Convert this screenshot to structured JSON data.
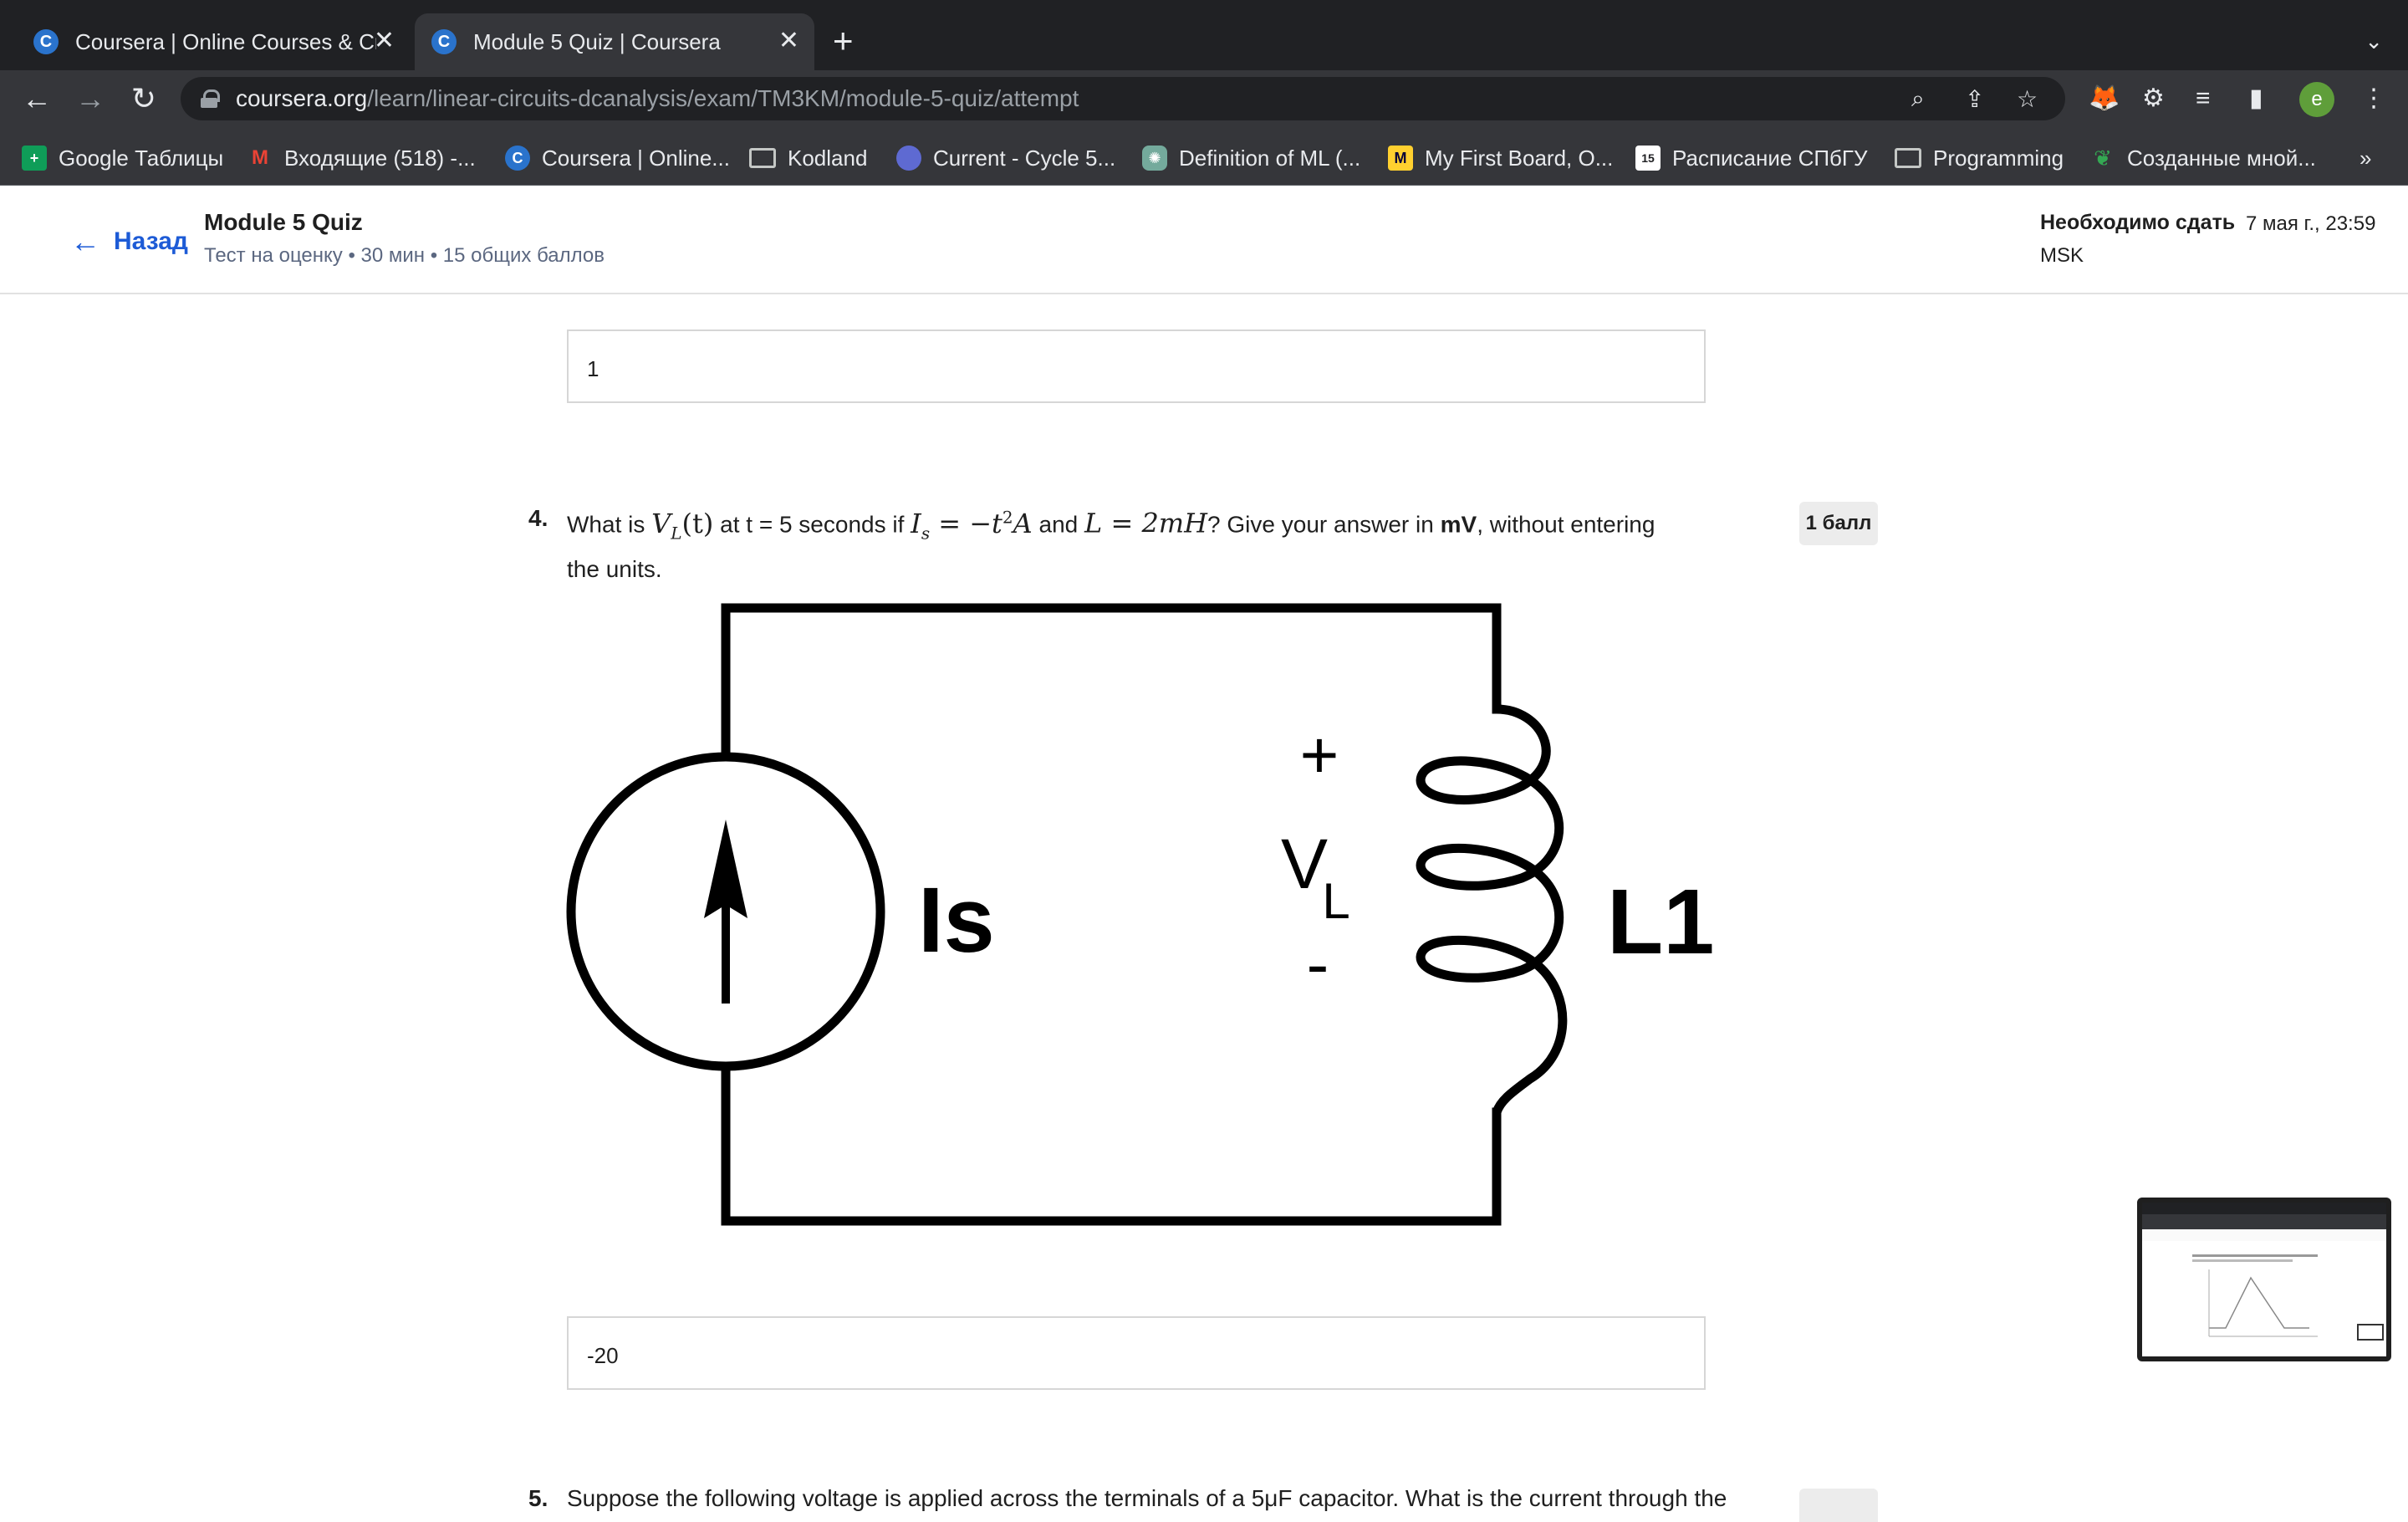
{
  "tabs": [
    {
      "title": "Coursera | Online Courses & Cr",
      "favicon": "C",
      "active": false
    },
    {
      "title": "Module 5 Quiz | Coursera",
      "favicon": "C",
      "active": true
    }
  ],
  "address_bar": {
    "host": "coursera.org",
    "path": "/learn/linear-circuits-dcanalysis/exam/TM3KM/module-5-quiz/attempt"
  },
  "bookmarks": [
    {
      "label": "Google Таблицы",
      "icon": "sheets-icon",
      "color": "#0f9d58"
    },
    {
      "label": "Входящие (518) -...",
      "icon": "gmail-icon",
      "color": "#ea4335"
    },
    {
      "label": "Coursera | Online...",
      "icon": "coursera-icon",
      "color": "#2a73cc"
    },
    {
      "label": "Kodland",
      "icon": "folder-icon",
      "color": "#c4c7c5"
    },
    {
      "label": "Current - Cycle 5...",
      "icon": "linear-icon",
      "color": "#5e6ad2"
    },
    {
      "label": "Definition of ML (...",
      "icon": "chatgpt-icon",
      "color": "#74aa9c"
    },
    {
      "label": "My First Board, O...",
      "icon": "miro-icon",
      "color": "#ffd02f"
    },
    {
      "label": "Расписание СПбГУ",
      "icon": "calendar-icon",
      "color": "#ffffff"
    },
    {
      "label": "Programming",
      "icon": "folder-icon",
      "color": "#c4c7c5"
    },
    {
      "label": "Созданные мной...",
      "icon": "leaf-icon",
      "color": "#34a853"
    }
  ],
  "bookmarks_overflow": "»",
  "header": {
    "back_label": "Назад",
    "quiz_title": "Module 5 Quiz",
    "quiz_subtitle": "Тест на оценку • 30 мин • 15 общих баллов",
    "due_label": "Необходимо сдать",
    "due_value": "7 мая г., 23:59",
    "due_timezone": "MSK"
  },
  "previous_answer": {
    "value": "1"
  },
  "question4": {
    "number": "4.",
    "text_parts": {
      "p1": "What is ",
      "m1": "V",
      "m1_sub": "L",
      "m1_rest": "(t)",
      "p2": " at t = 5 seconds if ",
      "m2": "I",
      "m2_sub": "s",
      "m2_rest": " = −t",
      "m2_sup": "2",
      "m2_end": "A",
      "p3": " and ",
      "m3": "L = 2mH",
      "p4": "? Give your answer in ",
      "bold": "mV",
      "p5": ", without entering the units."
    },
    "points": "1 балл",
    "answer": "-20",
    "circuit_labels": {
      "source": "Is",
      "plus": "+",
      "voltage": "V",
      "voltage_sub": "L",
      "minus": "-",
      "inductor": "L1"
    }
  },
  "question5": {
    "number": "5.",
    "text": "Suppose the following voltage is applied across the terminals of a 5μF capacitor. What is the current through the"
  },
  "colors": {
    "link_blue": "#1d5bd6",
    "chrome_dark": "#202124",
    "chrome_toolbar": "#35363a",
    "badge_bg": "#ececec"
  }
}
